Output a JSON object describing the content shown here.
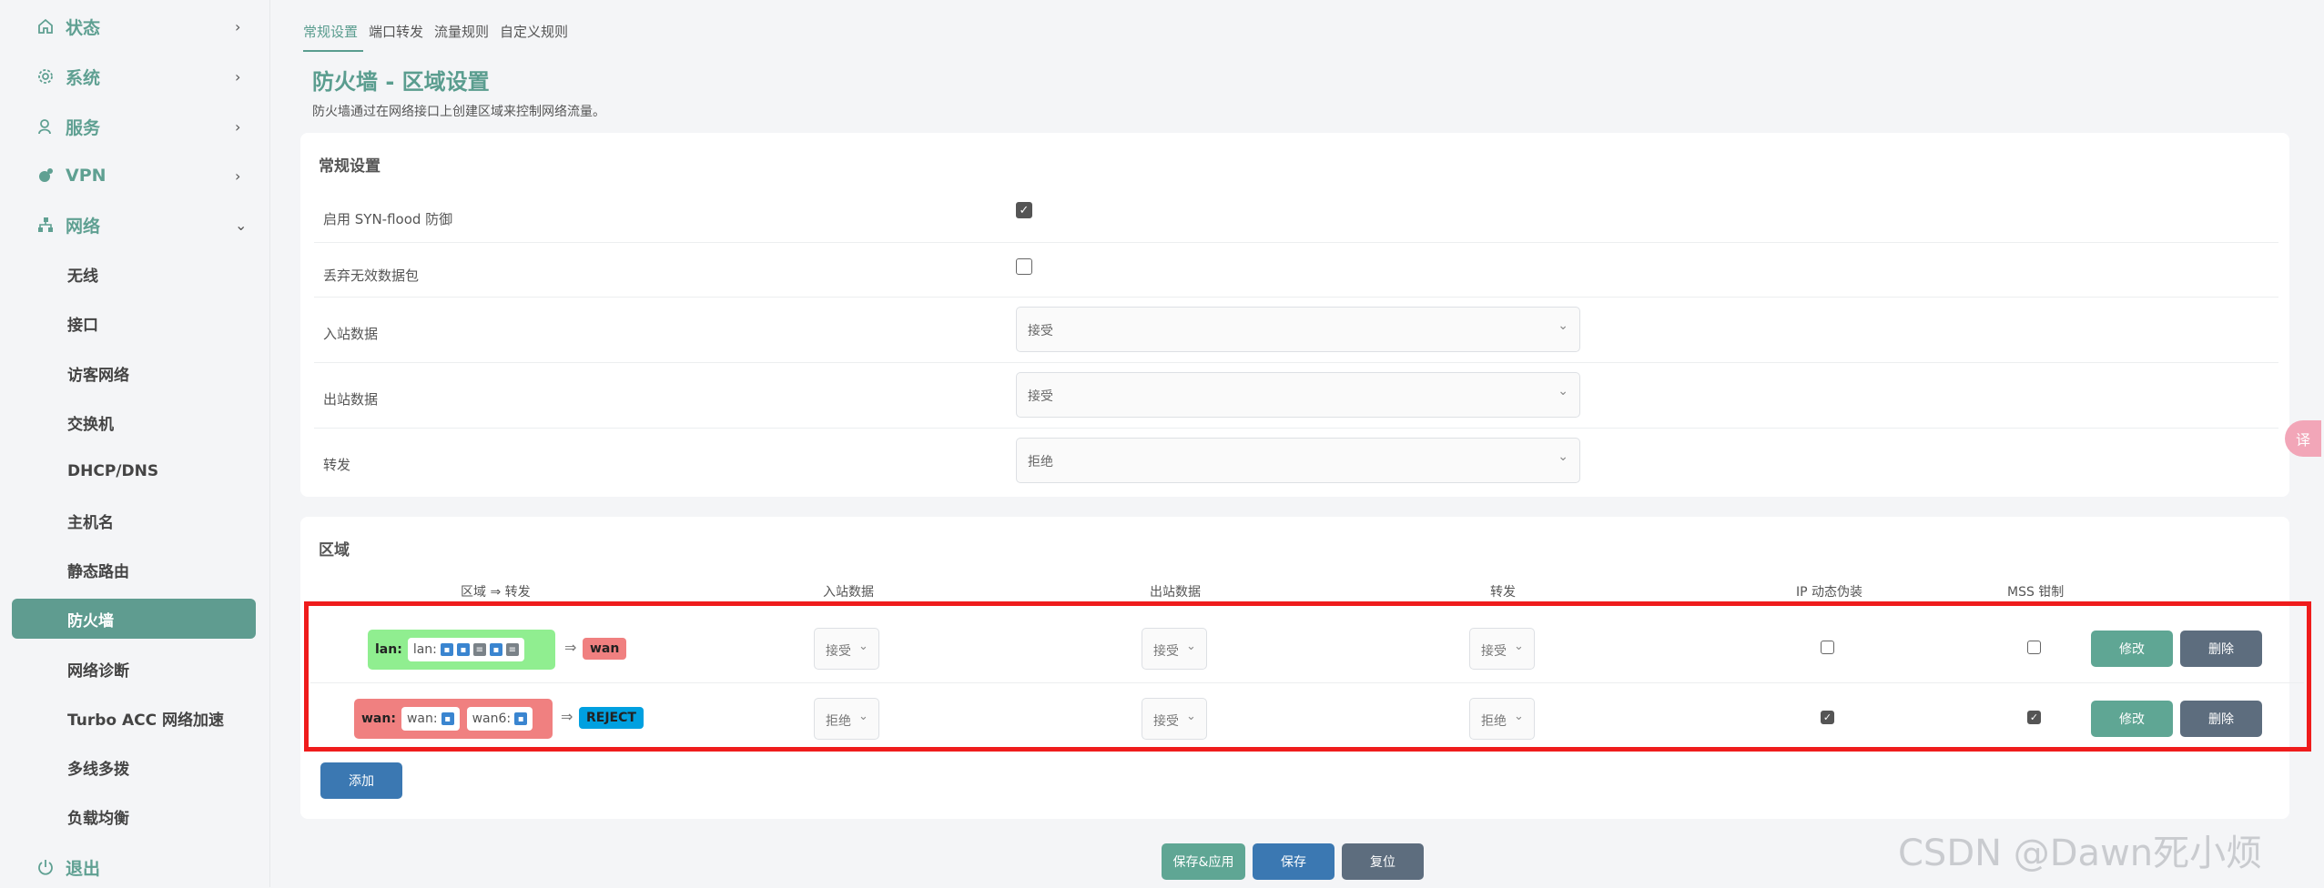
{
  "sidebar": {
    "top_items": [
      {
        "label": "状态",
        "icon": "home-icon"
      },
      {
        "label": "系统",
        "icon": "gear-icon"
      },
      {
        "label": "服务",
        "icon": "user-icon"
      },
      {
        "label": "VPN",
        "icon": "vpn-icon"
      },
      {
        "label": "网络",
        "icon": "network-icon"
      }
    ],
    "chevrons": [
      "›",
      "›",
      "›",
      "›",
      "⌄"
    ],
    "network_items": [
      "无线",
      "接口",
      "访客网络",
      "交换机",
      "DHCP/DNS",
      "主机名",
      "静态路由",
      "防火墙",
      "网络诊断",
      "Turbo ACC 网络加速",
      "多线多拨",
      "负载均衡"
    ],
    "logout": {
      "label": "退出",
      "icon": "power-icon"
    }
  },
  "tabs": [
    "常规设置",
    "端口转发",
    "流量规则",
    "自定义规则"
  ],
  "page": {
    "title": "防火墙 - 区域设置",
    "description": "防火墙通过在网络接口上创建区域来控制网络流量。"
  },
  "general": {
    "title": "常规设置",
    "rows": {
      "syn_flood": {
        "label": "启用 SYN-flood 防御",
        "checked": true
      },
      "drop_invalid": {
        "label": "丢弃无效数据包",
        "checked": false
      },
      "input": {
        "label": "入站数据",
        "value": "接受"
      },
      "output": {
        "label": "出站数据",
        "value": "接受"
      },
      "forward": {
        "label": "转发",
        "value": "拒绝"
      }
    }
  },
  "zones": {
    "title": "区域",
    "headers": [
      "区域 ⇒ 转发",
      "入站数据",
      "出站数据",
      "转发",
      "IP 动态伪装",
      "MSS 钳制"
    ],
    "rows": [
      {
        "name": "lan:",
        "networks": [
          {
            "label": "lan:"
          }
        ],
        "forward_to": "wan",
        "input": "接受",
        "output": "接受",
        "forward": "接受",
        "masq": false,
        "mss": false,
        "color": "#90ee90",
        "dest_color": "#f08080"
      },
      {
        "name": "wan:",
        "networks": [
          {
            "label": "wan:"
          },
          {
            "label": "wan6:"
          }
        ],
        "forward_to": "REJECT",
        "input": "拒绝",
        "output": "接受",
        "forward": "拒绝",
        "masq": true,
        "mss": true,
        "color": "#f08080",
        "dest_color": "#00a0e0"
      }
    ],
    "arrow": "⇒",
    "edit_label": "修改",
    "delete_label": "删除",
    "add_label": "添加"
  },
  "footer": {
    "save_apply": "保存&应用",
    "save": "保存",
    "reset": "复位"
  },
  "watermark": "CSDN @Dawn死小烦",
  "float_button": "译"
}
